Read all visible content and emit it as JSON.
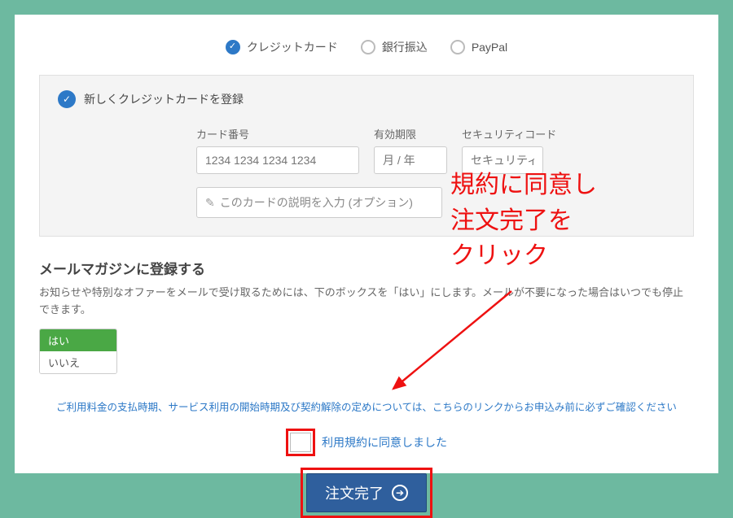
{
  "payment": {
    "credit_label": "クレジットカード",
    "bank_label": "銀行振込",
    "paypal_label": "PayPal"
  },
  "card": {
    "register_new": "新しくクレジットカードを登録",
    "number_label": "カード番号",
    "number_placeholder": "1234 1234 1234 1234",
    "expiry_label": "有効期限",
    "expiry_placeholder": "月 / 年",
    "security_label": "セキュリティコード",
    "security_placeholder": "セキュリティ",
    "desc_placeholder": "このカードの説明を入力 (オプション)"
  },
  "newsletter": {
    "title": "メールマガジンに登録する",
    "desc": "お知らせや特別なオファーをメールで受け取るためには、下のボックスを「はい」にします。メールが不要になった場合はいつでも停止できます。",
    "yes": "はい",
    "no": "いいえ"
  },
  "terms_line": "ご利用料金の支払時期、サービス利用の開始時期及び契約解除の定めについては、こちらのリンクからお申込み前に必ずご確認ください",
  "agree_label": "利用規約に同意しました",
  "submit_label": "注文完了",
  "annotation": {
    "line1": "規約に同意し",
    "line2": "注文完了を",
    "line3": "クリック"
  }
}
